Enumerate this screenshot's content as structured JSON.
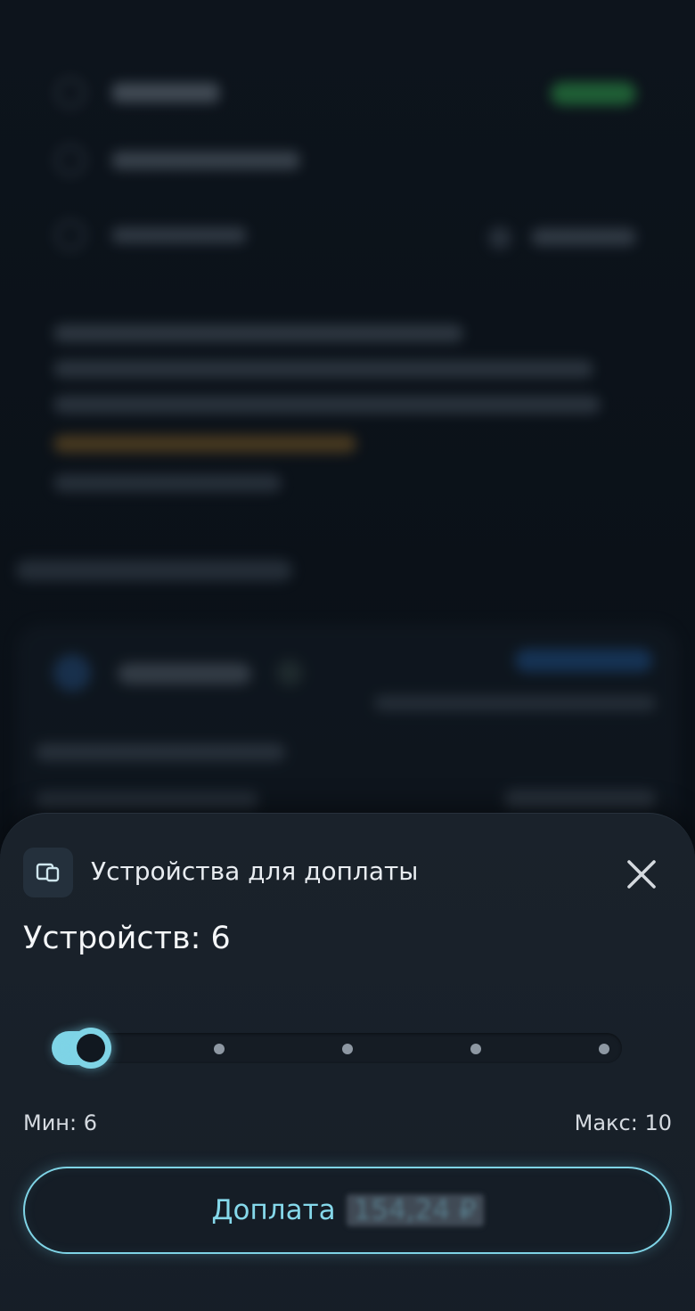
{
  "sheet": {
    "title": "Устройства для доплаты",
    "device_count_label": "Устройств: 6",
    "min_label": "Мин: 6",
    "max_label": "Макс: 10",
    "pay_button_label": "Доплата",
    "pay_amount": "154,24 ₽",
    "icons": {
      "header": "devices-icon",
      "close": "close-icon"
    }
  },
  "slider": {
    "min": 6,
    "max": 10,
    "value": 6,
    "stops": [
      6,
      7,
      8,
      9,
      10
    ]
  },
  "colors": {
    "accent": "#7fd4e6",
    "sheet_background": "#1a222b",
    "text_primary": "#e9edf1"
  }
}
